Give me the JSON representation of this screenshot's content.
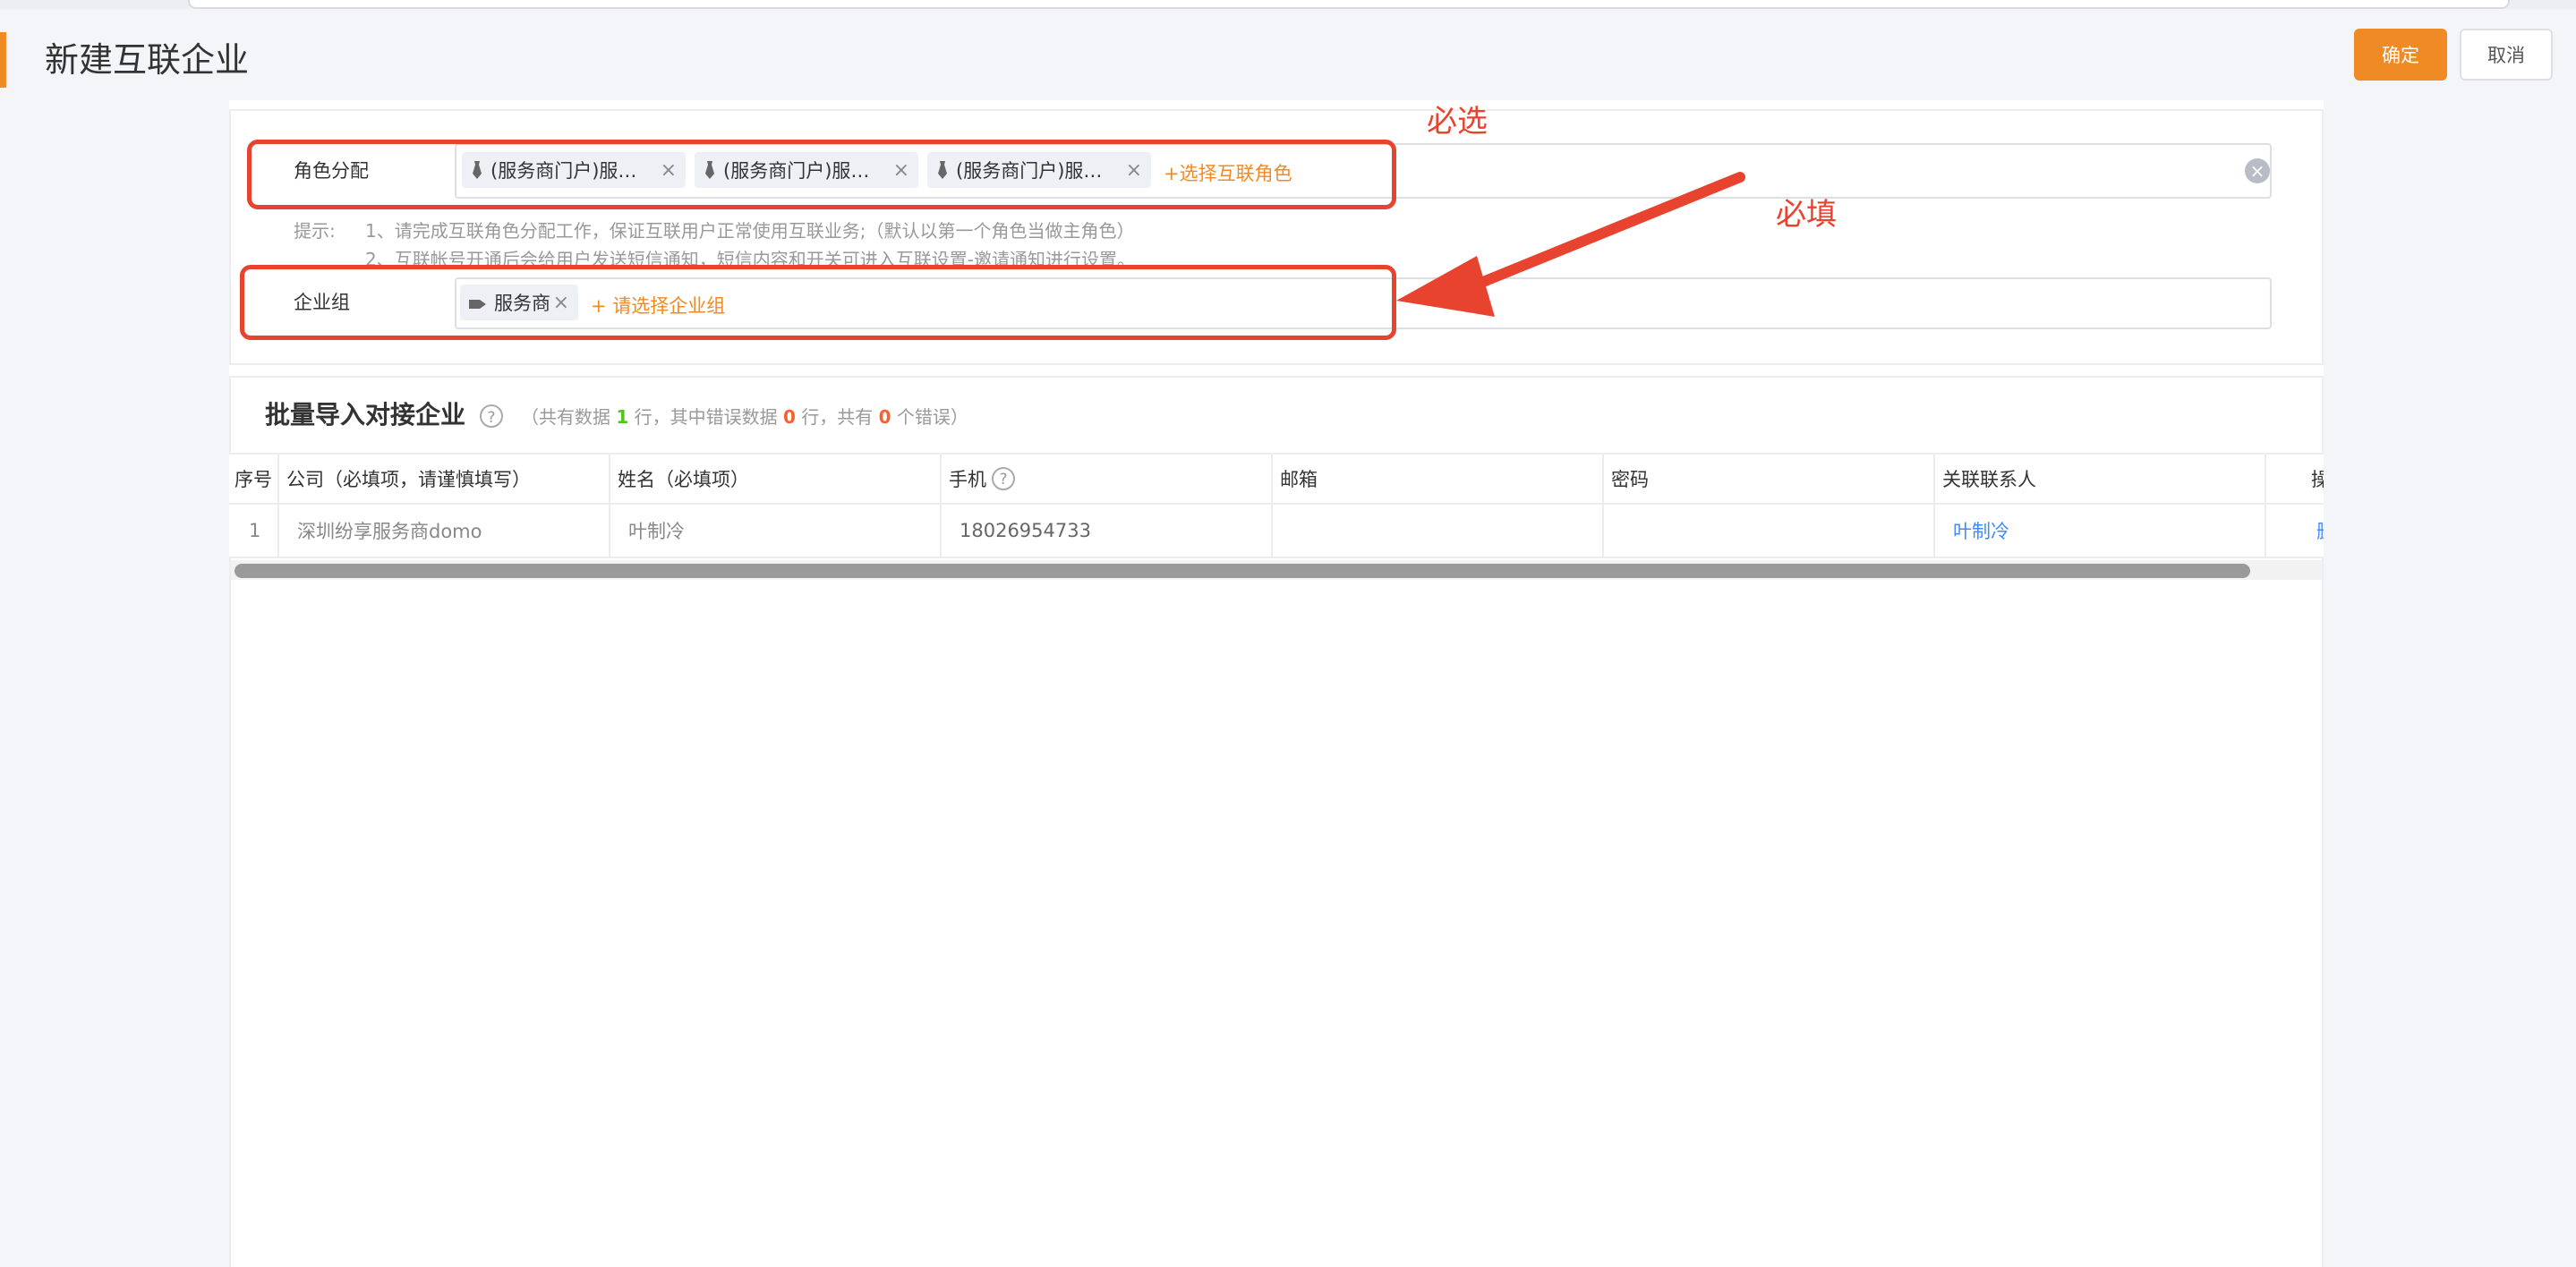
{
  "header": {
    "title": "新建互联企业",
    "confirm_label": "确定",
    "cancel_label": "取消"
  },
  "role": {
    "label": "角色分配",
    "tags": [
      "(服务商门户)服…",
      "(服务商门户)服…",
      "(服务商门户)服…"
    ],
    "add_label": "+选择互联角色"
  },
  "hints": {
    "prefix": "提示:",
    "line1": "1、请完成互联角色分配工作，保证互联用户正常使用互联业务;（默认以第一个角色当做主角色）",
    "line2": "2、互联帐号开通后会给用户发送短信通知，短信内容和开关可进入互联设置-邀请通知进行设置。"
  },
  "group": {
    "label": "企业组",
    "tag": "服务商",
    "add_label": "+ 请选择企业组"
  },
  "annotations": {
    "required_select": "必选",
    "required_fill": "必填"
  },
  "import": {
    "title": "批量导入对接企业",
    "stats_prefix": "（共有数据",
    "total_rows": "1",
    "stats_mid1": "行，其中错误数据",
    "error_rows": "0",
    "stats_mid2": "行，共有",
    "error_count": "0",
    "stats_suffix": "个错误）"
  },
  "table": {
    "headers": [
      "序号",
      "公司（必填项，请谨慎填写）",
      "姓名（必填项）",
      "手机",
      "邮箱",
      "密码",
      "关联联系人",
      "操"
    ],
    "rows": [
      [
        "1",
        "深圳纷享服务商domo",
        "叶制冷",
        "18026954733",
        "",
        "",
        "叶制冷",
        "删"
      ]
    ]
  },
  "colors": {
    "accent": "#f08a24",
    "annotation_red": "#e8432e",
    "link_blue": "#3d8bfd"
  }
}
